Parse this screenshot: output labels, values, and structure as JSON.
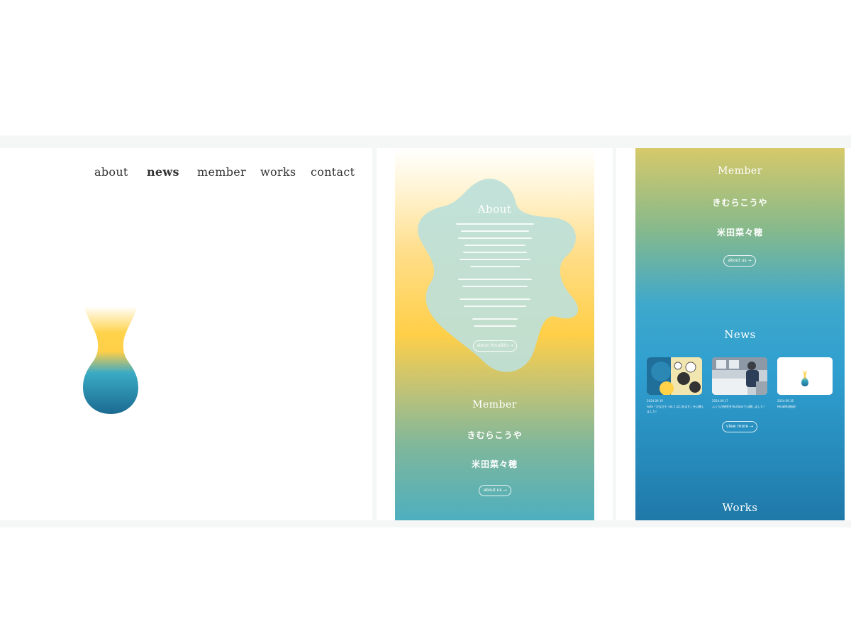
{
  "nav": {
    "about": "about",
    "news": "news",
    "member": "member",
    "works": "works",
    "contact": "contact"
  },
  "about_section": {
    "title": "About",
    "button": "about HinaBito →"
  },
  "member_section": {
    "title": "Member",
    "members": [
      "きむらこうや",
      "米田菜々穂"
    ],
    "button": "about us →"
  },
  "news_section": {
    "title": "News",
    "items": [
      {
        "date": "2024.09.19",
        "title": "note「ひなびと vol.1 はじめます」を公開しました！"
      },
      {
        "date": "2024.09.17",
        "title": "ふくらび研究をYouTubeで公開しました！"
      },
      {
        "date": "2024.09.16",
        "title": "HinaBito結成！"
      }
    ],
    "button": "view more →"
  },
  "works_section": {
    "title": "Works"
  },
  "colors": {
    "yellow": "#ffcf48",
    "teal": "#4eafbf",
    "blue": "#2f9fd0",
    "navy": "#1f6f9a"
  }
}
